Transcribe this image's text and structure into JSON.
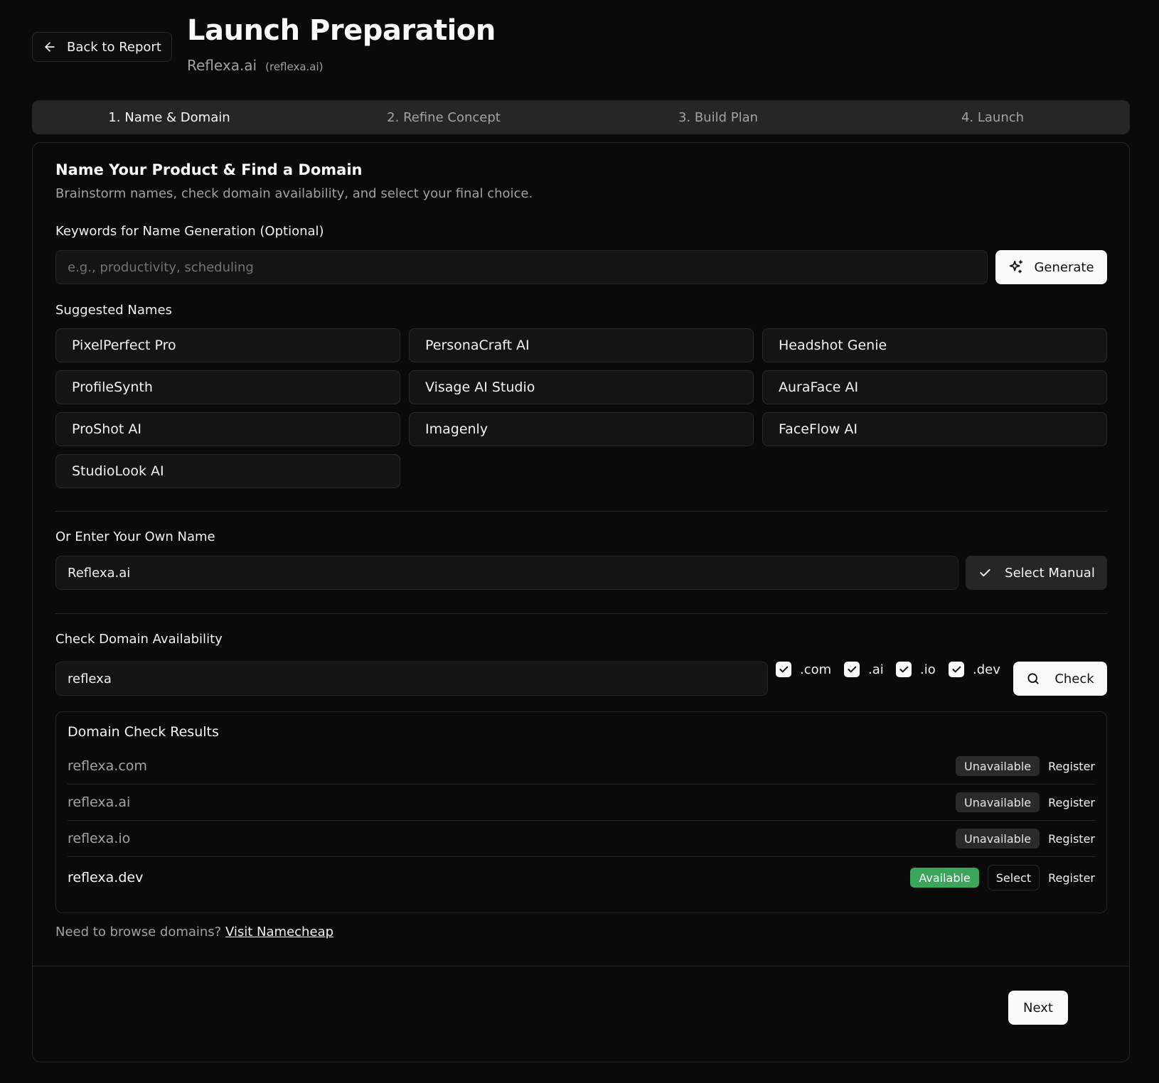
{
  "header": {
    "back_label": "Back to Report",
    "title": "Launch Preparation",
    "product_name": "Reflexa.ai",
    "product_domain": "(reflexa.ai)"
  },
  "tabs": [
    {
      "label": "1. Name & Domain",
      "active": true
    },
    {
      "label": "2. Refine Concept",
      "active": false
    },
    {
      "label": "3. Build Plan",
      "active": false
    },
    {
      "label": "4. Launch",
      "active": false
    }
  ],
  "section": {
    "title": "Name Your Product & Find a Domain",
    "description": "Brainstorm names, check domain availability, and select your final choice."
  },
  "keywords": {
    "label": "Keywords for Name Generation (Optional)",
    "placeholder": "e.g., productivity, scheduling",
    "value": "",
    "generate_label": "Generate"
  },
  "suggested": {
    "label": "Suggested Names",
    "names": [
      "PixelPerfect Pro",
      "PersonaCraft AI",
      "Headshot Genie",
      "ProfileSynth",
      "Visage AI Studio",
      "AuraFace AI",
      "ProShot AI",
      "Imagenly",
      "FaceFlow AI",
      "StudioLook AI"
    ]
  },
  "own_name": {
    "label": "Or Enter Your Own Name",
    "value": "Reflexa.ai",
    "select_label": "Select Manual"
  },
  "domain_check": {
    "label": "Check Domain Availability",
    "value": "reflexa",
    "tlds": [
      {
        "label": ".com",
        "checked": true
      },
      {
        "label": ".ai",
        "checked": true
      },
      {
        "label": ".io",
        "checked": true
      },
      {
        "label": ".dev",
        "checked": true
      }
    ],
    "check_label": "Check"
  },
  "results": {
    "title": "Domain Check Results",
    "rows": [
      {
        "domain": "reflexa.com",
        "status": "Unavailable",
        "register": "Register"
      },
      {
        "domain": "reflexa.ai",
        "status": "Unavailable",
        "register": "Register"
      },
      {
        "domain": "reflexa.io",
        "status": "Unavailable",
        "register": "Register"
      },
      {
        "domain": "reflexa.dev",
        "status": "Available",
        "select": "Select",
        "register": "Register"
      }
    ]
  },
  "browse": {
    "text": "Need to browse domains?",
    "link": "Visit Namecheap"
  },
  "footer": {
    "next_label": "Next"
  },
  "colors": {
    "background": "#0a0a0a",
    "surface": "#141414",
    "border": "#262626",
    "available": "#3ba55c"
  },
  "icons": {
    "back": "arrow-left-icon",
    "generate": "sparkles-icon",
    "select_manual": "check-icon",
    "check": "search-icon"
  }
}
